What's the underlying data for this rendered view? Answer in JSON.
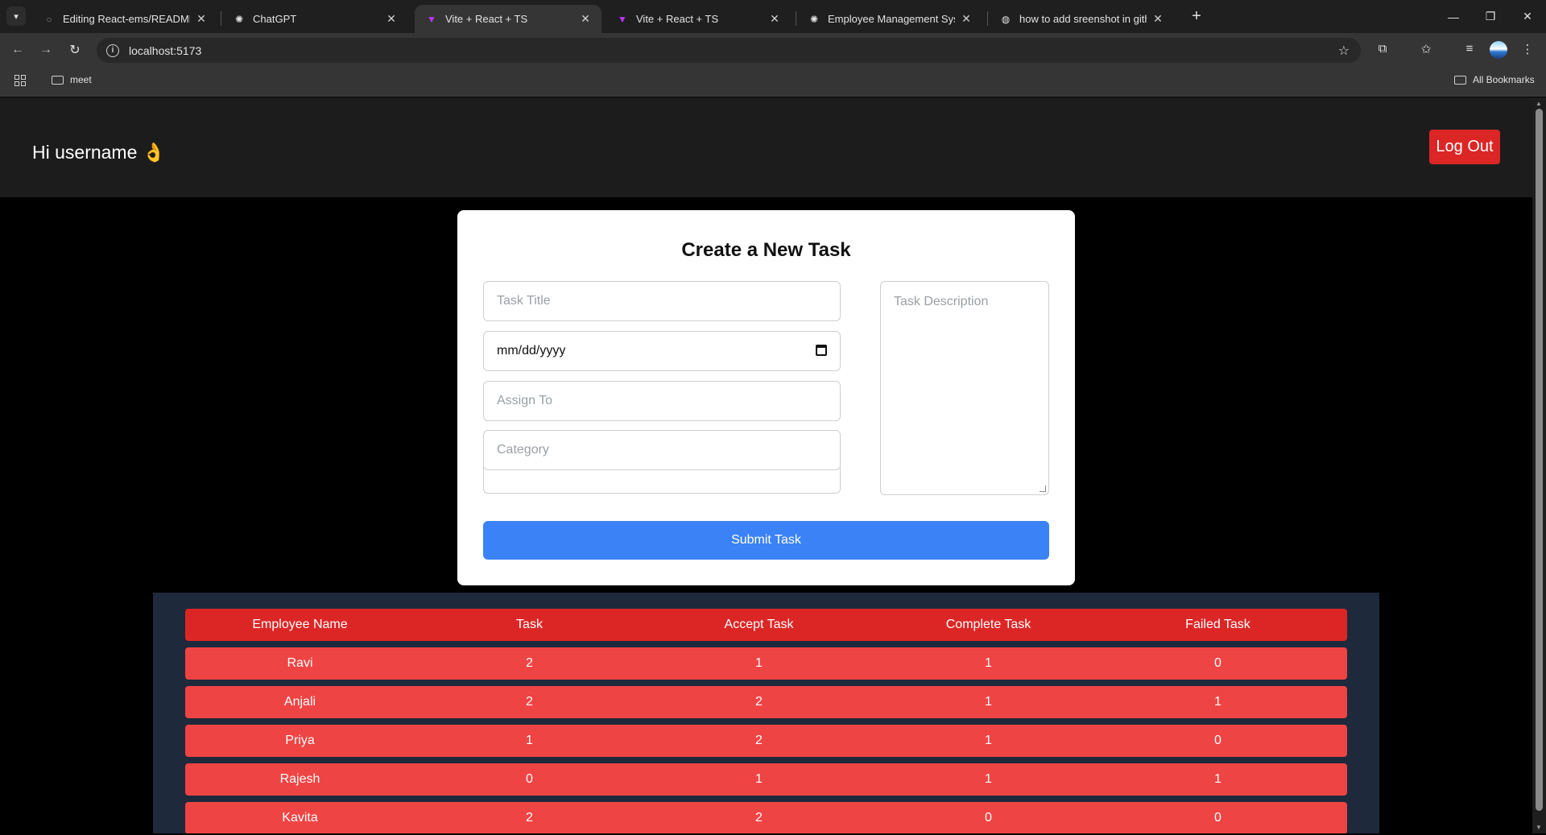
{
  "browser": {
    "tabs": [
      {
        "title": "Editing React-ems/README.md",
        "icon": "github-icon"
      },
      {
        "title": "ChatGPT",
        "icon": "chatgpt-icon"
      },
      {
        "title": "Vite + React + TS",
        "icon": "vite-icon",
        "active": true
      },
      {
        "title": "Vite + React + TS",
        "icon": "vite-icon"
      },
      {
        "title": "Employee Management System",
        "icon": "chatgpt-icon"
      },
      {
        "title": "how to add sreenshot in github",
        "icon": "globe-icon"
      }
    ],
    "url": "localhost:5173",
    "bookmarks": {
      "folder": "meet",
      "all": "All Bookmarks"
    }
  },
  "header": {
    "greeting": "Hi username 👌",
    "logout_label": "Log Out"
  },
  "form": {
    "title": "Create a New Task",
    "task_title_placeholder": "Task Title",
    "date_placeholder": "mm/dd/yyyy",
    "assign_placeholder": "Assign To",
    "category_placeholder": "Category",
    "description_placeholder": "Task Description",
    "submit_label": "Submit Task"
  },
  "table": {
    "columns": [
      "Employee Name",
      "Task",
      "Accept Task",
      "Complete Task",
      "Failed Task"
    ],
    "rows": [
      [
        "Ravi",
        "2",
        "1",
        "1",
        "0"
      ],
      [
        "Anjali",
        "2",
        "2",
        "1",
        "1"
      ],
      [
        "Priya",
        "1",
        "2",
        "1",
        "0"
      ],
      [
        "Rajesh",
        "0",
        "1",
        "1",
        "1"
      ],
      [
        "Kavita",
        "2",
        "2",
        "0",
        "0"
      ]
    ]
  },
  "colors": {
    "header_bg": "#1c1c1c",
    "logout": "#dc2626",
    "submit": "#3b82f6",
    "table_head": "#dc2626",
    "table_row": "#ef4444",
    "table_bg": "#1e293b"
  }
}
